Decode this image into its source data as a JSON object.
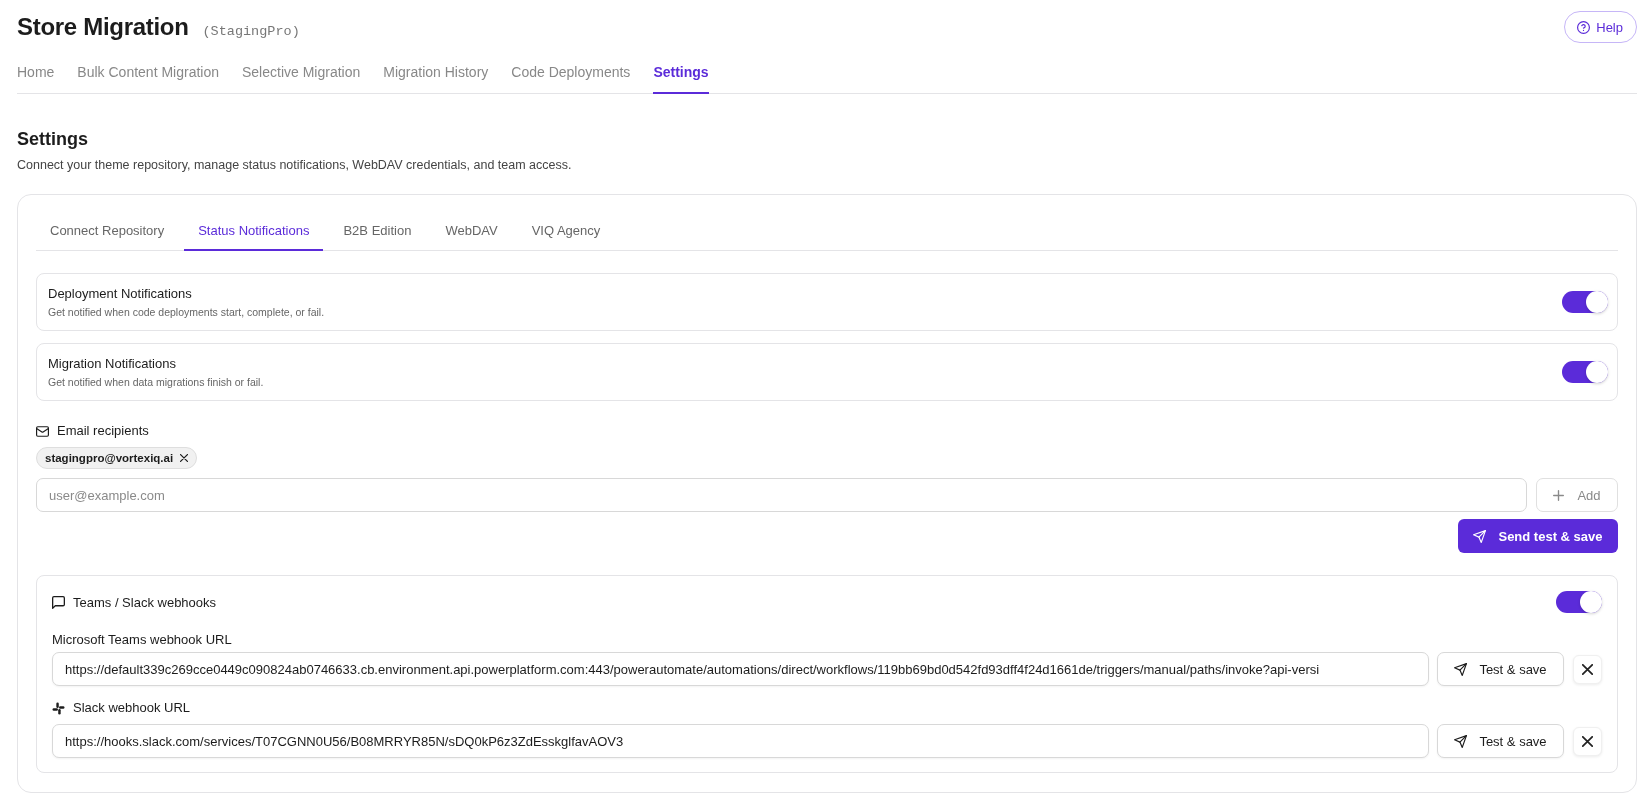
{
  "header": {
    "title": "Store Migration",
    "store": "(StagingPro)",
    "help_button": "Help"
  },
  "nav_tabs": [
    {
      "label": "Home",
      "selected": false
    },
    {
      "label": "Bulk Content Migration",
      "selected": false
    },
    {
      "label": "Selective Migration",
      "selected": false
    },
    {
      "label": "Migration History",
      "selected": false
    },
    {
      "label": "Code Deployments",
      "selected": false
    },
    {
      "label": "Settings",
      "selected": true
    }
  ],
  "page": {
    "title": "Settings",
    "description": "Connect your theme repository, manage status notifications, WebDAV credentials, and team access."
  },
  "settings_tabs": [
    {
      "label": "Connect Repository",
      "selected": false
    },
    {
      "label": "Status Notifications",
      "selected": true
    },
    {
      "label": "B2B Edition",
      "selected": false
    },
    {
      "label": "WebDAV",
      "selected": false
    },
    {
      "label": "VIQ Agency",
      "selected": false
    }
  ],
  "notification_toggles": [
    {
      "title": "Deployment Notifications",
      "description": "Get notified when code deployments start, complete, or fail.",
      "on": true
    },
    {
      "title": "Migration Notifications",
      "description": "Get notified when data migrations finish or fail.",
      "on": true
    }
  ],
  "email": {
    "label": "Email recipients",
    "recipients": [
      "stagingpro@vortexiq.ai"
    ],
    "input": {
      "placeholder": "user@example.com"
    },
    "add_button": "Add",
    "send_button": "Send test & save"
  },
  "webhooks": {
    "title": "Teams / Slack webhooks",
    "on": true,
    "fields": [
      {
        "kind": "teams",
        "label": "Microsoft Teams webhook URL",
        "value": "https://default339c269cce0449c090824ab0746633.cb.environment.api.powerplatform.com:443/powerautomate/automations/direct/workflows/119bb69bd0d542fd93dff4f24d1661de/triggers/manual/paths/invoke?api-versi",
        "test_button": "Test & save"
      },
      {
        "kind": "slack",
        "label": "Slack webhook URL",
        "value": "https://hooks.slack.com/services/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",
        "test_button": "Test & save"
      }
    ]
  }
}
